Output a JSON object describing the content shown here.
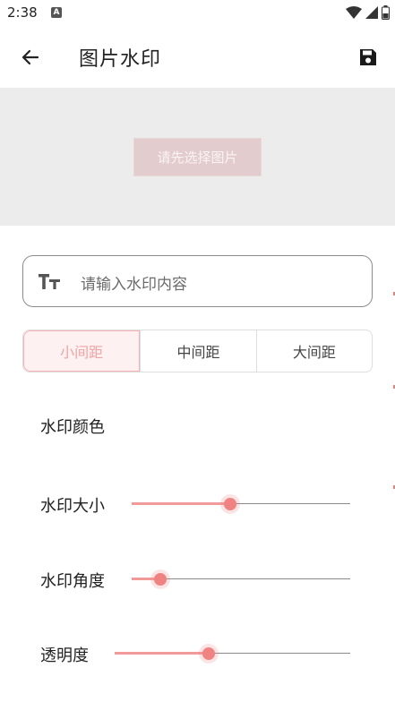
{
  "status_bar": {
    "time": "2:38",
    "notification_letter": "A"
  },
  "app_bar": {
    "title": "图片水印"
  },
  "preview": {
    "select_button_label": "请先选择图片"
  },
  "watermark_input": {
    "placeholder": "请输入水印内容",
    "value": ""
  },
  "spacing": {
    "options": [
      "小间距",
      "中间距",
      "大间距"
    ],
    "selected_index": 0
  },
  "settings": {
    "color_label": "水印颜色",
    "size_label": "水印大小",
    "size_value": 0.45,
    "angle_label": "水印角度",
    "angle_value": 0.13,
    "opacity_label": "透明度",
    "opacity_value": 0.4
  },
  "colors": {
    "accent": "#f08282",
    "accent_light": "#fdf1f1",
    "preview_bg": "#ececec",
    "select_button_bg": "#e2cccd"
  },
  "icons": {
    "back": "arrow-left-icon",
    "save": "floppy-save-icon",
    "text": "text-size-icon",
    "wifi": "wifi-icon",
    "signal": "signal-icon",
    "battery": "battery-icon"
  }
}
